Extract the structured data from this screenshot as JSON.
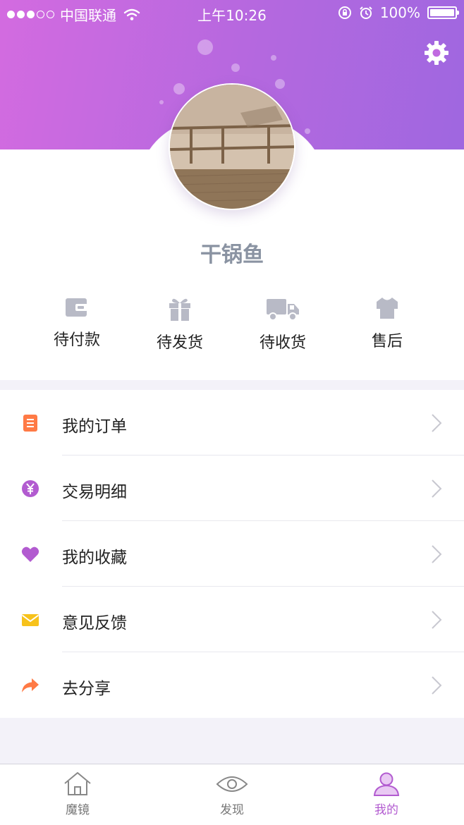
{
  "status_bar": {
    "carrier": "中国联通",
    "time": "上午10:26",
    "battery": "100%"
  },
  "profile": {
    "username": "干锅鱼"
  },
  "orders": [
    {
      "label": "待付款",
      "icon": "wallet-icon"
    },
    {
      "label": "待发货",
      "icon": "gift-icon"
    },
    {
      "label": "待收货",
      "icon": "truck-icon"
    },
    {
      "label": "售后",
      "icon": "shirt-icon"
    }
  ],
  "menu": [
    {
      "label": "我的订单",
      "icon": "order-list-icon",
      "color": "#ff7a45"
    },
    {
      "label": "交易明细",
      "icon": "yen-icon",
      "color": "#b25bd0"
    },
    {
      "label": "我的收藏",
      "icon": "heart-icon",
      "color": "#b25bd0"
    },
    {
      "label": "意见反馈",
      "icon": "mail-icon",
      "color": "#f7c21b"
    },
    {
      "label": "去分享",
      "icon": "share-icon",
      "color": "#ff7a45"
    }
  ],
  "tabbar": [
    {
      "label": "魔镜",
      "icon": "home-icon",
      "active": false
    },
    {
      "label": "发现",
      "icon": "eye-icon",
      "active": false
    },
    {
      "label": "我的",
      "icon": "user-icon",
      "active": true
    }
  ],
  "colors": {
    "accent": "#b25bd0",
    "header_gradient_start": "#d36be0",
    "header_gradient_end": "#9f67e0"
  }
}
